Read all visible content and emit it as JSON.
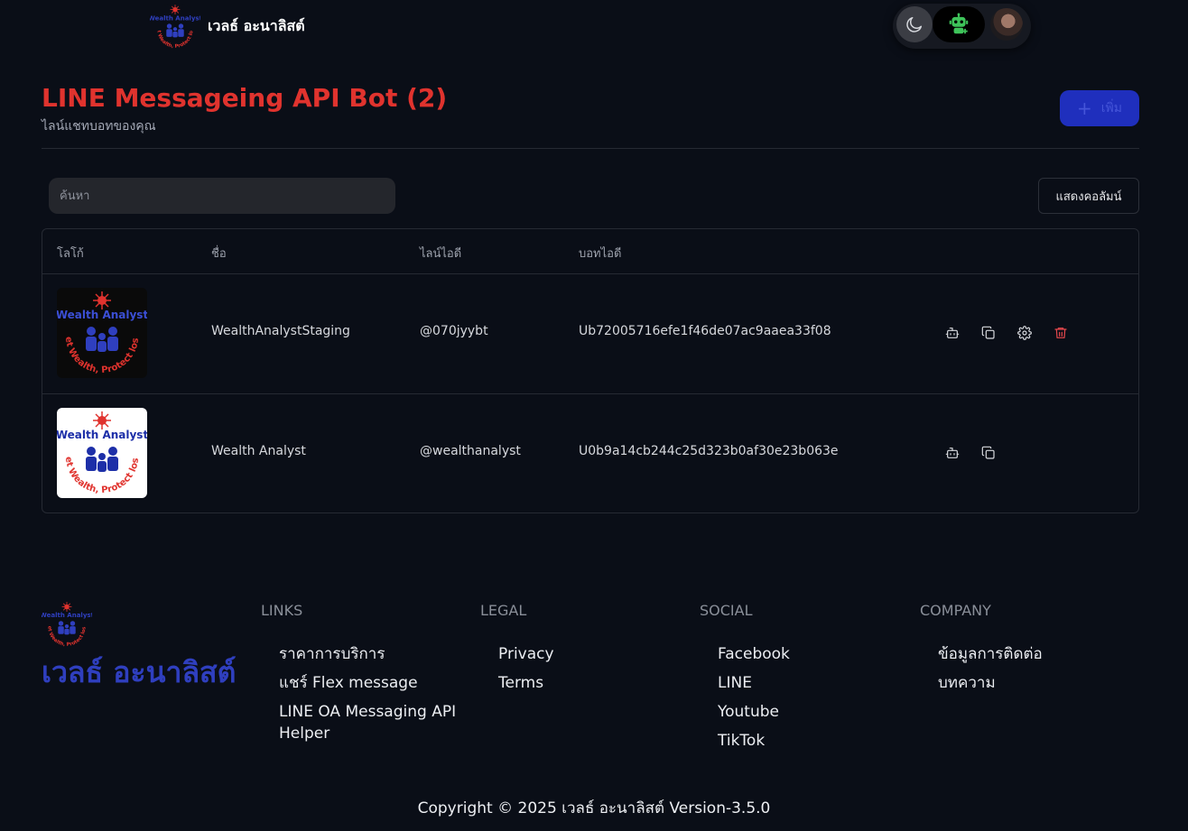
{
  "header": {
    "brand_name": "เวลธ์ อะนาลิสต์",
    "logo_text_top": "Wealth Analyst",
    "logo_text_bottom": "Get Wealth, Protect loss."
  },
  "page": {
    "title": "LINE Messageing API Bot (2)",
    "subtitle": "ไลน์แชทบอทของคุณ",
    "add_button_label": "เพิ่ม"
  },
  "toolbar": {
    "search_placeholder": "ค้นหา",
    "columns_button_label": "แสดงคอลัมน์"
  },
  "table": {
    "headers": [
      "โลโก้",
      "ชื่อ",
      "ไลน์ไอดี",
      "บอทไอดี"
    ],
    "rows": [
      {
        "name": "WealthAnalystStaging",
        "line_id": "@070jyybt",
        "bot_id": "Ub72005716efe1f46de07ac9aaea33f08",
        "logo_style": "dark",
        "actions": [
          "bot-icon",
          "copy-icon",
          "settings-icon",
          "trash-icon"
        ]
      },
      {
        "name": "Wealth Analyst",
        "line_id": "@wealthanalyst",
        "bot_id": "U0b9a14cb244c25d323b0af30e23b063e",
        "logo_style": "light",
        "actions": [
          "bot-icon",
          "copy-icon"
        ]
      }
    ]
  },
  "footer": {
    "brand_name": "เวลธ์ อะนาลิสต์",
    "columns": [
      {
        "heading": "LINKS",
        "links": [
          "ราคาการบริการ",
          "แชร์ Flex message",
          "LINE OA Messaging API Helper"
        ]
      },
      {
        "heading": "LEGAL",
        "links": [
          "Privacy",
          "Terms"
        ]
      },
      {
        "heading": "SOCIAL",
        "links": [
          "Facebook",
          "LINE",
          "Youtube",
          "TikTok"
        ]
      },
      {
        "heading": "COMPANY",
        "links": [
          "ข้อมูลการติดต่อ",
          "บทความ"
        ]
      }
    ],
    "copyright": "Copyright © 2025 เวลธ์ อะนาลิสต์ Version-3.5.0"
  },
  "colors": {
    "background": "#0a0e17",
    "title_red": "#e0332e",
    "primary_blue": "#1f2fbd",
    "delete_red": "#e5484d",
    "bot_green": "#3ec45a"
  }
}
